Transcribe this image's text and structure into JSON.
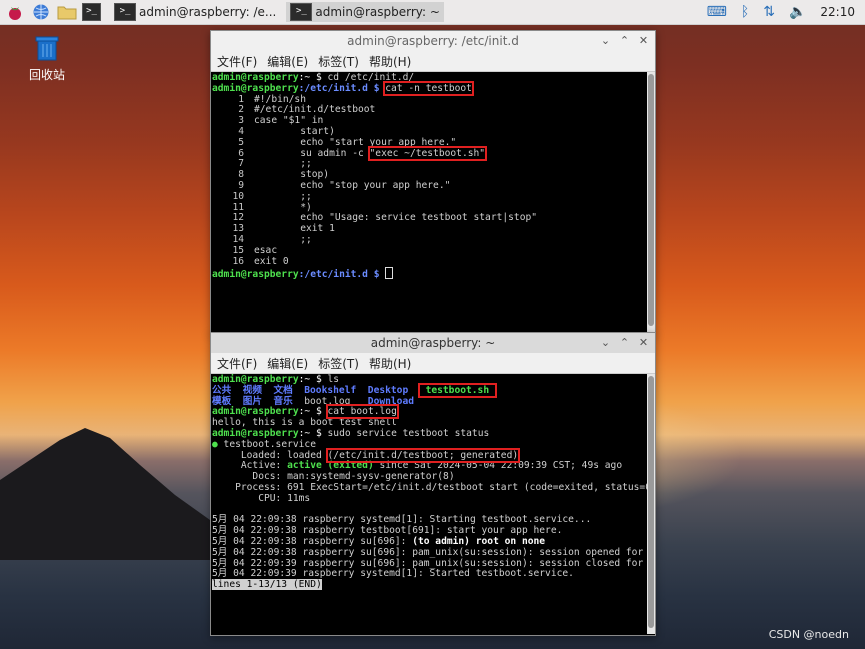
{
  "taskbar": {
    "tasks": [
      {
        "label": "admin@raspberry: /e..."
      },
      {
        "label": "admin@raspberry: ~"
      }
    ],
    "clock": "22:10"
  },
  "desktop": {
    "trash_label": "回收站",
    "watermark": "CSDN @noedn"
  },
  "window1": {
    "title": "admin@raspberry: /etc/init.d",
    "menu": [
      "文件(F)",
      "编辑(E)",
      "标签(T)",
      "帮助(H)"
    ],
    "prompt_user": "admin@raspberry",
    "lines": {
      "l1_path": ":~ $ ",
      "l1_cmd": "cd /etc/init.d/",
      "l2_path": ":/etc/init.d $ ",
      "l2_cmd": "cat -n testboot",
      "last_path": ":/etc/init.d $ "
    },
    "file_lines": [
      {
        "n": "1",
        "text": "#!/bin/sh"
      },
      {
        "n": "2",
        "text": "#/etc/init.d/testboot"
      },
      {
        "n": "3",
        "text": "case \"$1\" in"
      },
      {
        "n": "4",
        "text": "        start)"
      },
      {
        "n": "5",
        "text": "        echo \"start your app here.\""
      },
      {
        "n": "6",
        "text_a": "        su admin -c ",
        "text_b": "\"exec ~/testboot.sh\""
      },
      {
        "n": "7",
        "text": "        ;;"
      },
      {
        "n": "8",
        "text": "        stop)"
      },
      {
        "n": "9",
        "text": "        echo \"stop your app here.\""
      },
      {
        "n": "10",
        "text": "        ;;"
      },
      {
        "n": "11",
        "text": "        *)"
      },
      {
        "n": "12",
        "text": "        echo \"Usage: service testboot start|stop\""
      },
      {
        "n": "13",
        "text": "        exit 1"
      },
      {
        "n": "14",
        "text": "        ;;"
      },
      {
        "n": "15",
        "text": "esac"
      },
      {
        "n": "16",
        "text": "exit 0"
      }
    ]
  },
  "window2": {
    "title": "admin@raspberry: ~",
    "menu": [
      "文件(F)",
      "编辑(E)",
      "标签(T)",
      "帮助(H)"
    ],
    "prompt_user": "admin@raspberry",
    "prompt_home": ":~ $ ",
    "cmd_ls": "ls",
    "ls_row1": [
      "公共",
      "视频",
      "文档",
      "Bookshelf",
      "Desktop"
    ],
    "ls_row1_file": "testboot.sh",
    "ls_row2_dirs": [
      "模板",
      "图片",
      "音乐"
    ],
    "ls_row2_file": "boot.log",
    "ls_row2_dir2": "Download",
    "cmd_cat": "cat boot.log",
    "cat_output": "hello, this is a boot test shell",
    "cmd_status": "sudo service testboot status",
    "svc_dot": "●",
    "svc_name": " testboot.service",
    "loaded_label": "     Loaded: loaded ",
    "loaded_value": "(/etc/init.d/testboot; generated)",
    "active_label": "     Active: ",
    "active_value": "active (exited)",
    "active_rest": " since Sat 2024-05-04 22:09:39 CST; 49s ago",
    "docs": "       Docs: man:systemd-sysv-generator(8)",
    "process": "    Process: 691 ExecStart=/etc/init.d/testboot start (code=exited, status=0/SU",
    "cpu": "        CPU: 11ms",
    "log1": "5月 04 22:09:38 raspberry systemd[1]: Starting testboot.service...",
    "log2": "5月 04 22:09:38 raspberry testboot[691]: start your app here.",
    "log3_a": "5月 04 22:09:38 raspberry su[696]: ",
    "log3_b": "(to admin) root on none",
    "log4": "5月 04 22:09:38 raspberry su[696]: pam_unix(su:session): session opened for use",
    "log5": "5月 04 22:09:39 raspberry su[696]: pam_unix(su:session): session closed for use",
    "log6": "5月 04 22:09:39 raspberry systemd[1]: Started testboot.service.",
    "end_marker": "lines 1-13/13 (END)"
  }
}
